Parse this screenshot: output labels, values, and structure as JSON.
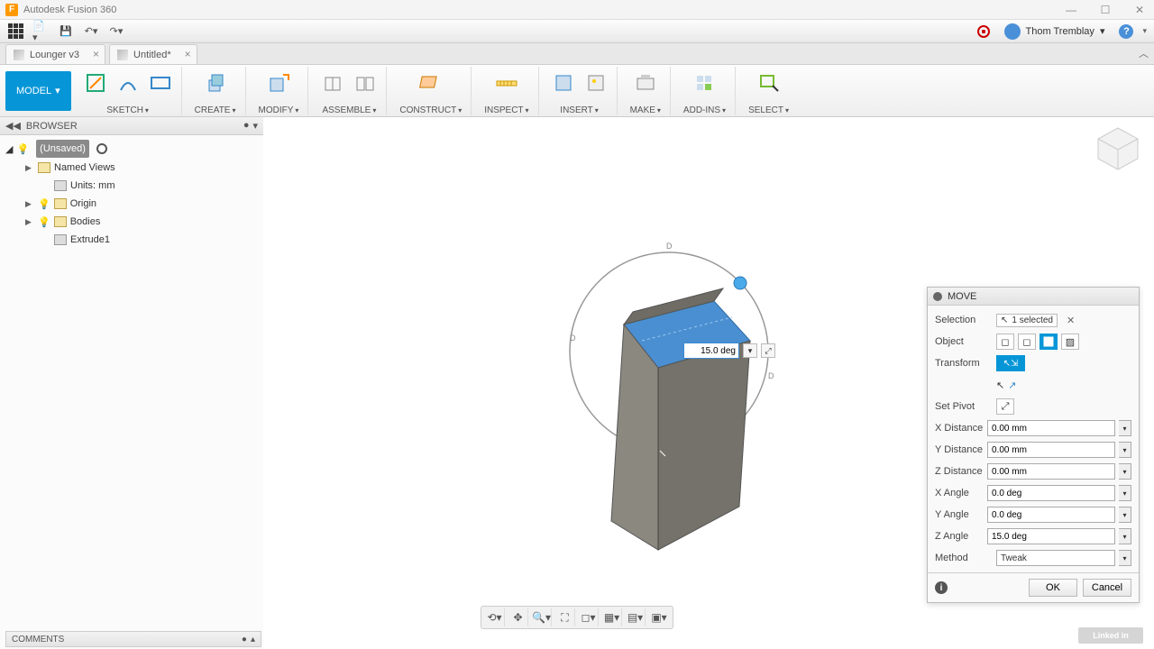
{
  "app": {
    "title": "Autodesk Fusion 360"
  },
  "user": {
    "name": "Thom Tremblay"
  },
  "tabs": [
    {
      "label": "Lounger v3"
    },
    {
      "label": "Untitled*"
    }
  ],
  "ribbon": {
    "model": "MODEL",
    "groups": [
      {
        "label": "SKETCH"
      },
      {
        "label": "CREATE"
      },
      {
        "label": "MODIFY"
      },
      {
        "label": "ASSEMBLE"
      },
      {
        "label": "CONSTRUCT"
      },
      {
        "label": "INSPECT"
      },
      {
        "label": "INSERT"
      },
      {
        "label": "MAKE"
      },
      {
        "label": "ADD-INS"
      },
      {
        "label": "SELECT"
      }
    ]
  },
  "browser": {
    "header": "BROWSER",
    "root": "(Unsaved)",
    "nodes": {
      "namedviews": "Named Views",
      "units": "Units: mm",
      "origin": "Origin",
      "bodies": "Bodies",
      "extrude": "Extrude1"
    }
  },
  "canvas": {
    "angle_input": "15.0 deg"
  },
  "move_panel": {
    "title": "MOVE",
    "rows": {
      "selection_label": "Selection",
      "selection_value": "1 selected",
      "object_label": "Object",
      "transform_label": "Transform",
      "setpivot_label": "Set Pivot",
      "xd_label": "X Distance",
      "xd_value": "0.00 mm",
      "yd_label": "Y Distance",
      "yd_value": "0.00 mm",
      "zd_label": "Z Distance",
      "zd_value": "0.00 mm",
      "xa_label": "X Angle",
      "xa_value": "0.0 deg",
      "ya_label": "Y Angle",
      "ya_value": "0.0 deg",
      "za_label": "Z Angle",
      "za_value": "15.0 deg",
      "method_label": "Method",
      "method_value": "Tweak"
    },
    "ok": "OK",
    "cancel": "Cancel"
  },
  "comments": {
    "label": "COMMENTS"
  },
  "watermark": "Linked in"
}
